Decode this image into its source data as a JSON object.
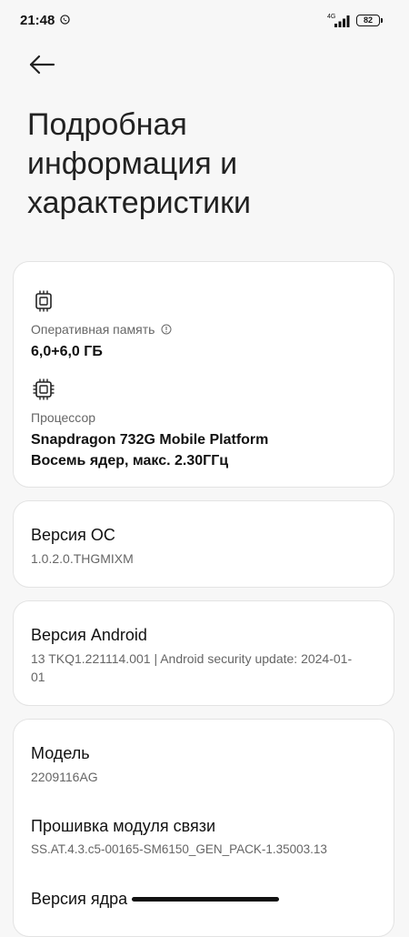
{
  "status_bar": {
    "time": "21:48",
    "network": "4G",
    "battery": "82"
  },
  "page": {
    "title": "Подробная информация и характеристики"
  },
  "specs": {
    "ram_label": "Оперативная память",
    "ram_value": "6,0+6,0 ГБ",
    "cpu_label": "Процессор",
    "cpu_value_line1": "Snapdragon 732G Mobile Platform",
    "cpu_value_line2": "Восемь ядер, макс. 2.30ГГц"
  },
  "os": {
    "title": "Версия ОС",
    "value": "1.0.2.0.THGMIXM"
  },
  "android": {
    "title": "Версия Android",
    "value": "13 TKQ1.221114.001 | Android security update: 2024-01-01"
  },
  "device": {
    "model_title": "Модель",
    "model_value": "2209116AG",
    "baseband_title": "Прошивка модуля связи",
    "baseband_value": "SS.AT.4.3.c5-00165-SM6150_GEN_PACK-1.35003.13",
    "kernel_title": "Версия ядра"
  },
  "icons": {
    "back": "back-arrow-icon",
    "memory": "memory-chip-icon",
    "cpu": "cpu-chip-icon",
    "info": "info-icon"
  }
}
